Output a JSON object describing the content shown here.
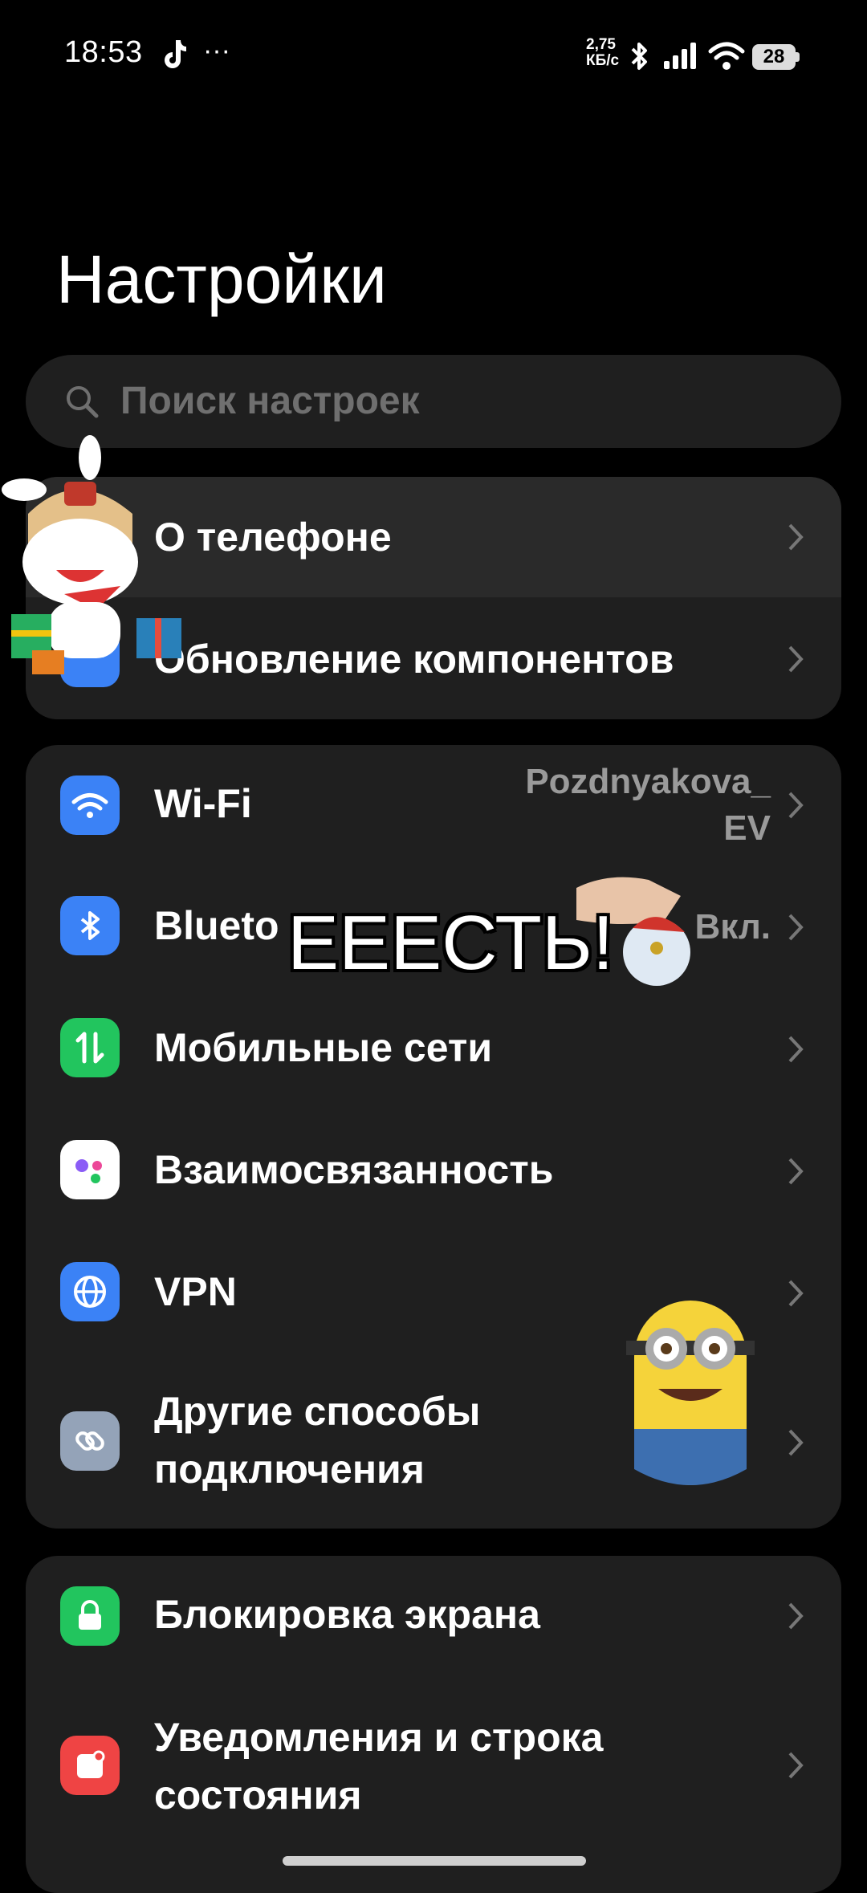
{
  "status_bar": {
    "time": "18:53",
    "net_speed_value": "2,75",
    "net_speed_unit": "КБ/с",
    "battery": "28"
  },
  "header": {
    "title": "Настройки"
  },
  "search": {
    "placeholder": "Поиск настроек"
  },
  "group1": [
    {
      "label": "О телефоне"
    },
    {
      "label": "Обновление компонентов"
    }
  ],
  "group2": [
    {
      "label": "Wi-Fi",
      "value_line1": "Pozdnyakova_",
      "value_line2": "EV",
      "icon": "wifi-icon",
      "color": "#3b82f6"
    },
    {
      "label": "Blueto",
      "value": "Вкл.",
      "icon": "bluetooth-icon",
      "color": "#3b82f6"
    },
    {
      "label": "Мобильные сети",
      "icon": "mobile-data-icon",
      "color": "#22c55e"
    },
    {
      "label": "Взаимосвязанность",
      "icon": "interconnect-icon",
      "color": "#ffffff"
    },
    {
      "label": "VPN",
      "icon": "globe-icon",
      "color": "#3b82f6"
    },
    {
      "label_line1": "Другие способы",
      "label_line2": "подключения",
      "icon": "link-icon",
      "color": "#94a3b8"
    }
  ],
  "group3": [
    {
      "label": "Блокировка экрана",
      "icon": "lock-icon",
      "color": "#22c55e"
    },
    {
      "label_line1": "Уведомления и строка",
      "label_line2": "состояния",
      "icon": "notification-icon",
      "color": "#ef4444"
    }
  ],
  "overlay": {
    "caption": "ЕЕЕСТЬ!"
  }
}
